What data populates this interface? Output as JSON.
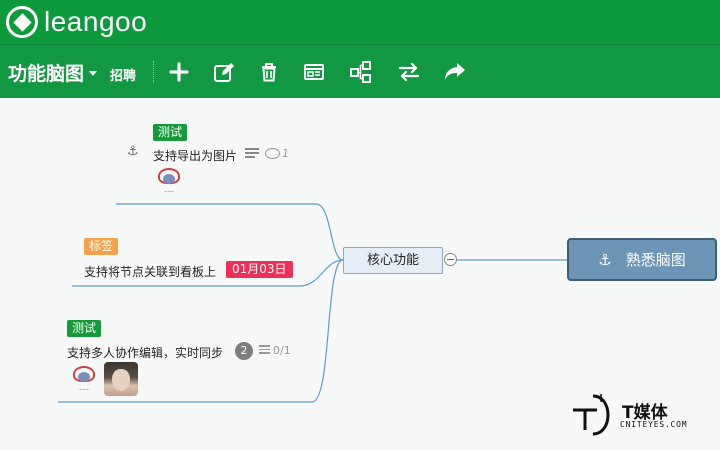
{
  "app": {
    "brand": "leangoo"
  },
  "toolbar": {
    "title": "功能脑图",
    "recruit": "招聘",
    "buttons": [
      {
        "name": "add-button",
        "icon": "plus-icon"
      },
      {
        "name": "edit-button",
        "icon": "edit-icon"
      },
      {
        "name": "delete-button",
        "icon": "trash-icon"
      },
      {
        "name": "card-button",
        "icon": "card-icon"
      },
      {
        "name": "structure-button",
        "icon": "tree-icon"
      },
      {
        "name": "swap-button",
        "icon": "swap-arrows-icon"
      },
      {
        "name": "share-button",
        "icon": "share-arrow-icon"
      }
    ]
  },
  "mindmap": {
    "root": {
      "label": "熟悉脑图",
      "icon": "anchor-icon"
    },
    "mid": {
      "label": "核心功能"
    },
    "nodes": [
      {
        "tag": "测试",
        "tag_color": "#149a3a",
        "text": "支持导出为图片",
        "comments": "1",
        "icon": "anchor-icon"
      },
      {
        "tag": "标签",
        "tag_color": "#f5a04a",
        "text": "支持将节点关联到看板上",
        "date": "01月03日"
      },
      {
        "tag": "测试",
        "tag_color": "#149a3a",
        "text": "支持多人协作编辑，实时同步",
        "count": "2",
        "checklist": "0/1"
      }
    ]
  },
  "colors": {
    "header": "#0d9a3c",
    "toolbar": "#129742",
    "root": "#6d95b6",
    "date": "#ee2f58"
  },
  "watermark": {
    "brand": "T媒体",
    "url": "CNITEYES.COM"
  }
}
